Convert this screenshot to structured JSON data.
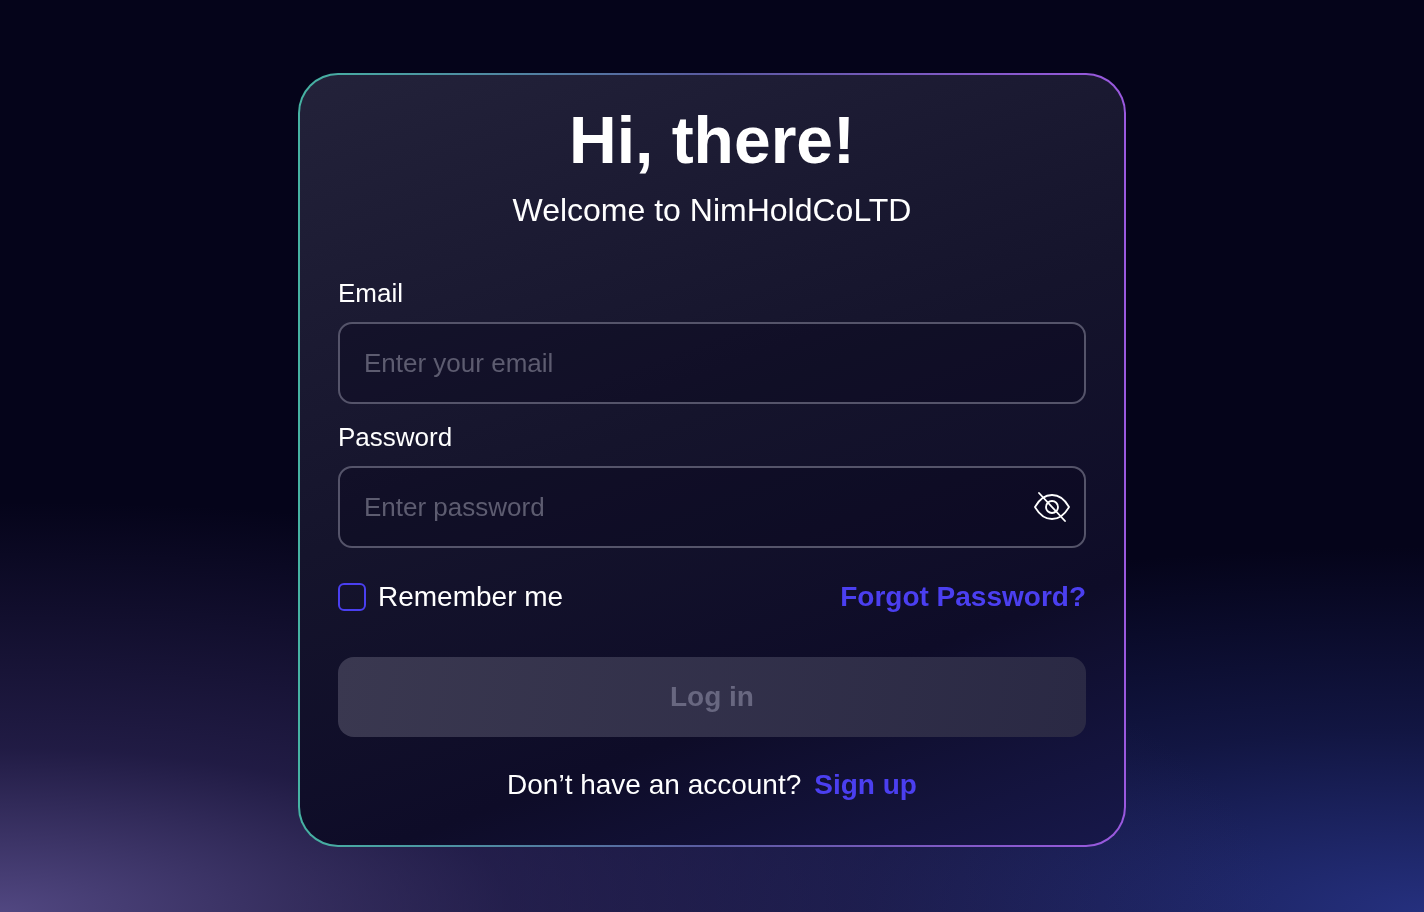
{
  "title": "Hi, there!",
  "subtitle": "Welcome to NimHoldCoLTD",
  "fields": [
    {
      "kind": "email",
      "label": "Email",
      "placeholder": "Enter your email"
    },
    {
      "kind": "password",
      "label": "Password",
      "placeholder": "Enter password"
    }
  ],
  "remember": {
    "label": "Remember me",
    "checked": false
  },
  "forgot_link": "Forgot Password?",
  "login_button": {
    "label": "Log in",
    "disabled": true
  },
  "signup": {
    "prompt": "Don’t have an account?",
    "link": "Sign up"
  }
}
